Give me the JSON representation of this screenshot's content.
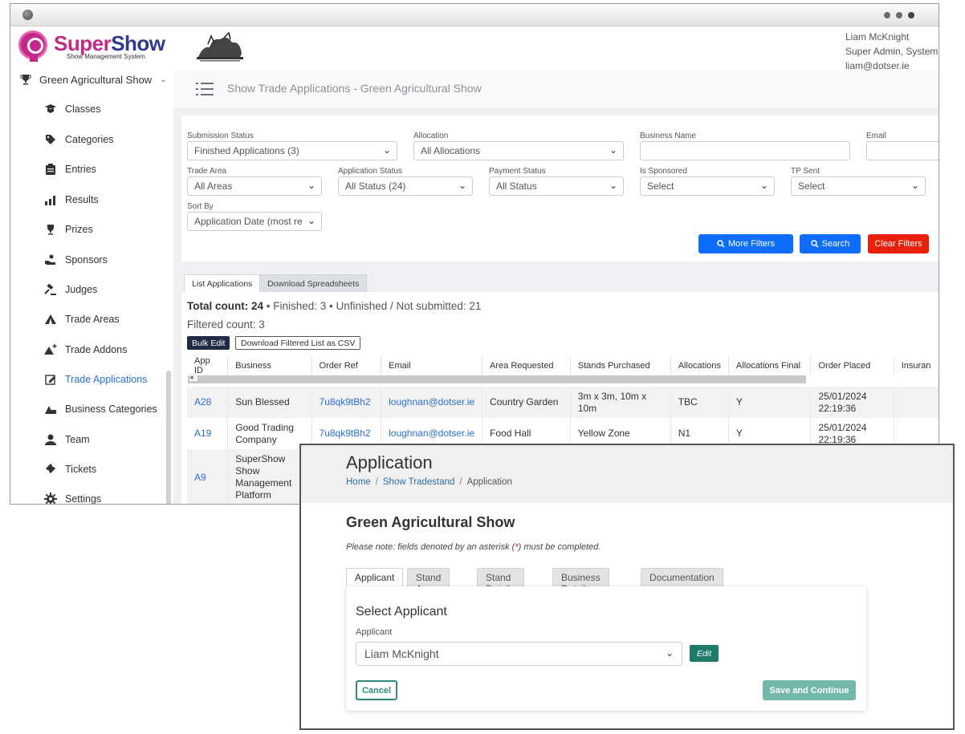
{
  "brand": {
    "name_part1": "Super",
    "name_part2": "Show",
    "tagline": "Show Management System"
  },
  "user": {
    "name": "Liam McKnight",
    "role": "Super Admin, System",
    "email": "liam@dotser.ie"
  },
  "sidebar": {
    "show_name": "Green Agricultural Show",
    "items": [
      {
        "label": "Classes",
        "icon": "classes-icon"
      },
      {
        "label": "Categories",
        "icon": "tag-icon"
      },
      {
        "label": "Entries",
        "icon": "clipboard-icon"
      },
      {
        "label": "Results",
        "icon": "chart-icon"
      },
      {
        "label": "Prizes",
        "icon": "trophy-icon"
      },
      {
        "label": "Sponsors",
        "icon": "hand-icon"
      },
      {
        "label": "Judges",
        "icon": "gavel-icon"
      },
      {
        "label": "Trade Areas",
        "icon": "tent-icon"
      },
      {
        "label": "Trade Addons",
        "icon": "tent-plus-icon"
      },
      {
        "label": "Trade Applications",
        "icon": "edit-icon",
        "active": true
      },
      {
        "label": "Business Categories",
        "icon": "category-icon"
      },
      {
        "label": "Team",
        "icon": "user-icon"
      },
      {
        "label": "Tickets",
        "icon": "ticket-icon"
      },
      {
        "label": "Settings",
        "icon": "gear-icon"
      }
    ]
  },
  "page": {
    "title": "Show Trade Applications - Green Agricultural Show"
  },
  "filters": {
    "submission_status": {
      "label": "Submission Status",
      "value": "Finished Applications (3)"
    },
    "allocation": {
      "label": "Allocation",
      "value": "All Allocations"
    },
    "business_name": {
      "label": "Business Name",
      "value": ""
    },
    "email": {
      "label": "Email",
      "value": ""
    },
    "trade_area": {
      "label": "Trade Area",
      "value": "All Areas"
    },
    "application_status": {
      "label": "Application Status",
      "value": "All Status (24)"
    },
    "payment_status": {
      "label": "Payment Status",
      "value": "All Status"
    },
    "is_sponsored": {
      "label": "Is Sponsored",
      "value": "Select"
    },
    "tp_sent": {
      "label": "TP Sent",
      "value": "Select"
    },
    "sort_by": {
      "label": "Sort By",
      "value": "Application Date (most re"
    },
    "more_filters": "More Filters",
    "search": "Search",
    "clear_filters": "Clear Filters"
  },
  "list": {
    "tabs": [
      "List Applications",
      "Download Spreadsheets"
    ],
    "total_label": "Total count: 24",
    "summary_rest": " • Finished: 3 • Unfinished / Not submitted: 21",
    "filtered": "Filtered count: 3",
    "bulk_edit": "Bulk Edit",
    "download_csv": "Download Filtered List as CSV",
    "columns": [
      "App ID",
      "Business",
      "Order Ref",
      "Email",
      "Area Requested",
      "Stands Purchased",
      "Allocations",
      "Allocations Final",
      "Order Placed",
      "Insuran"
    ],
    "rows": [
      {
        "app_id": "A28",
        "business": "Sun Blessed",
        "order_ref": "7u8qk9tBh2",
        "email": "loughnan@dotser.ie",
        "area": "Country Garden",
        "stands": "3m x 3m, 10m x 10m",
        "allocations": "TBC",
        "final": "Y",
        "order_placed": "25/01/2024 22:19:36"
      },
      {
        "app_id": "A19",
        "business": "Good Trading Company",
        "order_ref": "7u8qk9tBh2",
        "email": "loughnan@dotser.ie",
        "area": "Food Hall",
        "stands": "Yellow Zone",
        "allocations": "N1",
        "final": "Y",
        "order_placed": "25/01/2024 22:19:36"
      },
      {
        "app_id": "A9",
        "business": "SuperShow Show Management Platform",
        "order_ref": "",
        "email": "",
        "area": "",
        "stands": "",
        "allocations": "",
        "final": "",
        "order_placed": ""
      }
    ]
  },
  "application": {
    "title": "Application",
    "breadcrumb": [
      "Home",
      "Show Tradestand",
      "Application"
    ],
    "show_name": "Green Agricultural Show",
    "note_before": "Please note: fields denoted by an asterisk (",
    "note_star": "*",
    "note_after": ") must be completed.",
    "tabs": [
      "Applicant",
      "Stand Areas",
      "Stand Details",
      "Business Details",
      "Documentation"
    ],
    "section_title": "Select Applicant",
    "applicant_label": "Applicant",
    "applicant_value": "Liam McKnight",
    "edit": "Edit",
    "cancel": "Cancel",
    "save": "Save and Continue"
  }
}
